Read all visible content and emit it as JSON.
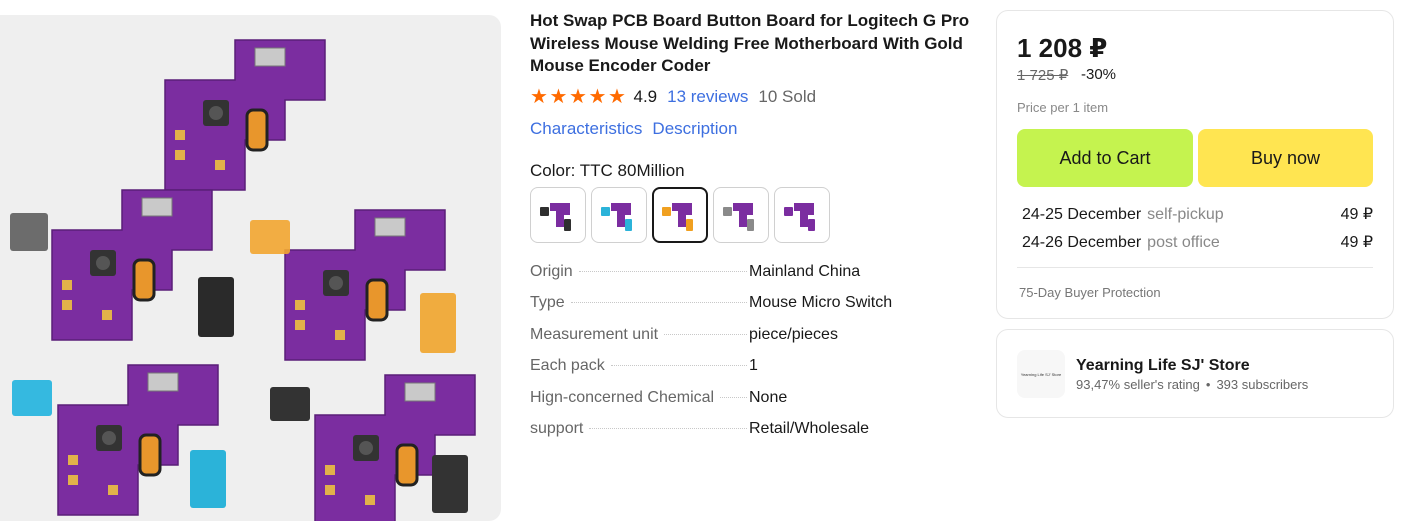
{
  "product": {
    "title": "Hot Swap PCB Board Button Board for Logitech G Pro Wireless Mouse Welding Free Motherboard With Gold Mouse Encoder Coder",
    "rating": "4.9",
    "reviews": "13 reviews",
    "sold": "10 Sold",
    "links": {
      "characteristics": "Characteristics",
      "description": "Description"
    },
    "color_label": "Color: TTC 80Million",
    "swatches": [
      {
        "switch_color": "#2f2f2f",
        "selected": false
      },
      {
        "switch_color": "#2bb3d9",
        "selected": false
      },
      {
        "switch_color": "#f0a020",
        "selected": true
      },
      {
        "switch_color": "#8a8a8a",
        "selected": false
      },
      {
        "switch_color": "#7b2da0",
        "selected": false
      }
    ],
    "specs": [
      {
        "key": "Origin",
        "value": "Mainland China"
      },
      {
        "key": "Type",
        "value": "Mouse Micro Switch"
      },
      {
        "key": "Measurement unit",
        "value": "piece/pieces"
      },
      {
        "key": "Each pack",
        "value": "1"
      },
      {
        "key": "Hign-concerned Chemical",
        "value": "None"
      },
      {
        "key": "support",
        "value": "Retail/Wholesale"
      }
    ]
  },
  "buy_box": {
    "price": "1 208 ₽",
    "old_price": "1 725 ₽",
    "discount": "-30%",
    "per_item": "Price per 1 item",
    "add_to_cart": "Add to Cart",
    "buy_now": "Buy now",
    "delivery": [
      {
        "date": "24-25 December",
        "method": "self-pickup",
        "cost": "49 ₽"
      },
      {
        "date": "24-26 December",
        "method": "post office",
        "cost": "49 ₽"
      }
    ],
    "protection": "75-Day Buyer Protection"
  },
  "store": {
    "logo_text": "Yearning Life SJ' Store",
    "name": "Yearning Life SJ' Store",
    "rating": "93,47% seller's rating",
    "separator": "•",
    "subscribers": "393 subscribers"
  },
  "colors": {
    "accent_link": "#3d6fe0",
    "star": "#ff6a00",
    "cart_button": "#c5f34f",
    "buy_button": "#ffe551",
    "pcb": "#7b2da0"
  }
}
